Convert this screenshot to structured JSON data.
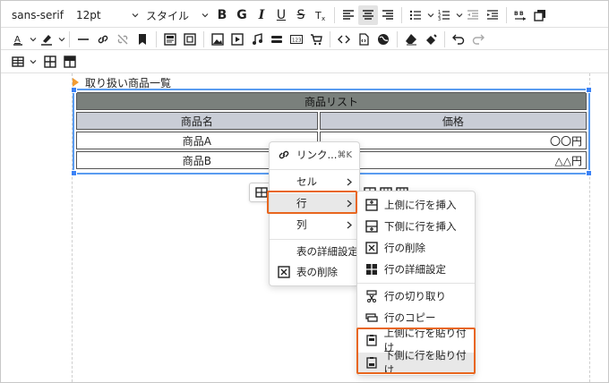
{
  "toolbar": {
    "font_family": "sans-serif",
    "font_size": "12pt",
    "style_label": "スタイル",
    "bold": "B",
    "italic": "I",
    "underline": "U",
    "strike": "S"
  },
  "caption": "取り扱い商品一覧",
  "table": {
    "title": "商品リスト",
    "headers": [
      "商品名",
      "価格"
    ],
    "rows": [
      [
        "商品A",
        "〇〇円"
      ],
      [
        "商品B",
        "△△円"
      ]
    ]
  },
  "context_menu": {
    "link": "リンク...",
    "link_shortcut": "⌘K",
    "cell": "セル",
    "row": "行",
    "column": "列",
    "table_props": "表の詳細設定",
    "delete_table": "表の削除"
  },
  "row_menu": {
    "insert_above": "上側に行を挿入",
    "insert_below": "下側に行を挿入",
    "delete_row": "行の削除",
    "row_props": "行の詳細設定",
    "cut_row": "行の切り取り",
    "copy_row": "行のコピー",
    "paste_above": "上側に行を貼り付け",
    "paste_below": "下側に行を貼り付け"
  },
  "colors": {
    "accent": "#e8661e",
    "selection": "#3b82f6",
    "table_title_bg": "#7a807c",
    "table_header_bg": "#c9cdd6"
  }
}
